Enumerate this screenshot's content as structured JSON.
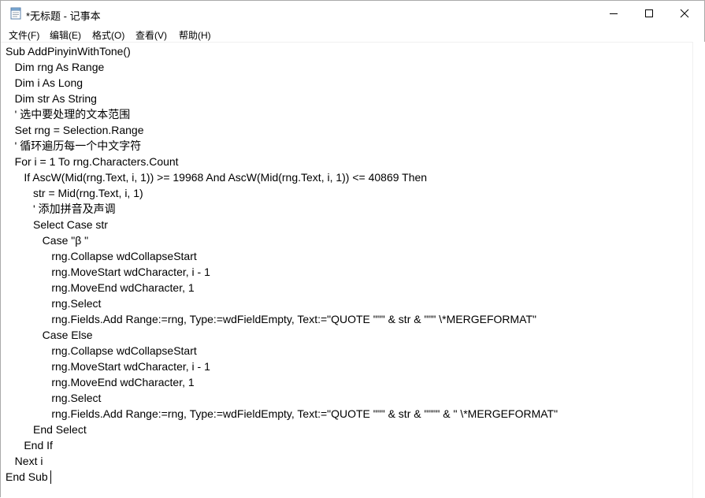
{
  "window": {
    "title": "*无标题 - 记事本"
  },
  "menu": [
    {
      "label": "文件(F)"
    },
    {
      "label": "编辑(E)"
    },
    {
      "label": "格式(O)"
    },
    {
      "label": "查看(V)"
    },
    {
      "label": "帮助(H)"
    }
  ],
  "editor": {
    "lines": [
      "Sub AddPinyinWithTone()",
      "   Dim rng As Range",
      "   Dim i As Long",
      "   Dim str As String",
      "   ' 选中要处理的文本范围",
      "   Set rng = Selection.Range",
      "   ' 循环遍历每一个中文字符",
      "   For i = 1 To rng.Characters.Count",
      "      If AscW(Mid(rng.Text, i, 1)) >= 19968 And AscW(Mid(rng.Text, i, 1)) <= 40869 Then",
      "         str = Mid(rng.Text, i, 1)",
      "         ' 添加拼音及声调",
      "         Select Case str",
      "            Case \"β \"",
      "               rng.Collapse wdCollapseStart",
      "               rng.MoveStart wdCharacter, i - 1",
      "               rng.MoveEnd wdCharacter, 1",
      "               rng.Select",
      "               rng.Fields.Add Range:=rng, Type:=wdFieldEmpty, Text:=\"QUOTE \"\"\" & str & \"\"\" \\*MERGEFORMAT\"",
      "            Case Else",
      "               rng.Collapse wdCollapseStart",
      "               rng.MoveStart wdCharacter, i - 1",
      "               rng.MoveEnd wdCharacter, 1",
      "               rng.Select",
      "               rng.Fields.Add Range:=rng, Type:=wdFieldEmpty, Text:=\"QUOTE \"\"\" & str & \"\"\"\" & \" \\*MERGEFORMAT\"",
      "         End Select",
      "      End If",
      "   Next i",
      "End Sub"
    ]
  },
  "icons": {
    "app": "notepad-icon",
    "minimize": "minimize-icon",
    "maximize": "maximize-icon",
    "close": "close-icon",
    "scroll_up": "scroll-up-arrow-icon"
  }
}
